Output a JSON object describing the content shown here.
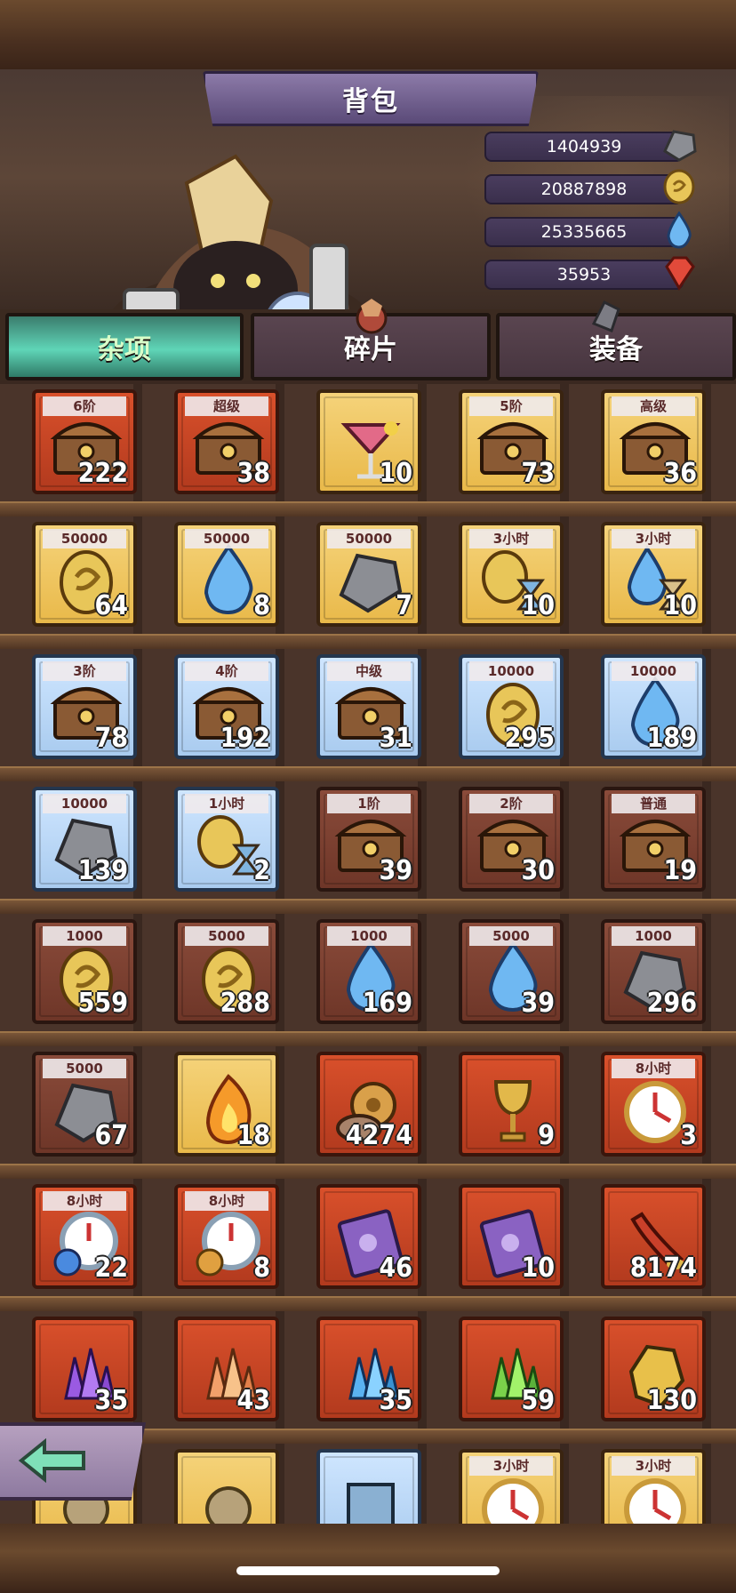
{
  "header": {
    "title": "背包"
  },
  "resources": [
    {
      "value": "1404939",
      "icon": "stone-icon"
    },
    {
      "value": "20887898",
      "icon": "gold-coin-icon"
    },
    {
      "value": "25335665",
      "icon": "water-drop-icon"
    },
    {
      "value": "35953",
      "icon": "red-gem-icon"
    }
  ],
  "tabs": [
    {
      "label": "杂项",
      "active": true
    },
    {
      "label": "碎片",
      "active": false
    },
    {
      "label": "装备",
      "active": false
    }
  ],
  "items": [
    [
      {
        "tag": "6阶",
        "count": "222",
        "icon": "chest-icon",
        "bg": "red"
      },
      {
        "tag": "超级",
        "count": "38",
        "icon": "chest-icon",
        "bg": "red"
      },
      {
        "tag": "",
        "count": "10",
        "icon": "cocktail-icon",
        "bg": "gold"
      },
      {
        "tag": "5阶",
        "count": "73",
        "icon": "chest-icon",
        "bg": "gold"
      },
      {
        "tag": "高级",
        "count": "36",
        "icon": "chest-icon",
        "bg": "gold"
      }
    ],
    [
      {
        "tag": "50000",
        "count": "64",
        "icon": "gold-coin-icon",
        "bg": "gold"
      },
      {
        "tag": "50000",
        "count": "8",
        "icon": "water-drop-icon",
        "bg": "gold"
      },
      {
        "tag": "50000",
        "count": "7",
        "icon": "stone-icon",
        "bg": "gold"
      },
      {
        "tag": "3小时",
        "count": "10",
        "icon": "coin-hourglass-icon",
        "bg": "gold"
      },
      {
        "tag": "3小时",
        "count": "10",
        "icon": "drop-hourglass-icon",
        "bg": "gold"
      }
    ],
    [
      {
        "tag": "3阶",
        "count": "78",
        "icon": "chest-icon",
        "bg": "blue"
      },
      {
        "tag": "4阶",
        "count": "192",
        "icon": "chest-icon",
        "bg": "blue"
      },
      {
        "tag": "中级",
        "count": "31",
        "icon": "chest-icon",
        "bg": "blue"
      },
      {
        "tag": "10000",
        "count": "295",
        "icon": "gold-coin-icon",
        "bg": "blue"
      },
      {
        "tag": "10000",
        "count": "189",
        "icon": "water-drop-icon",
        "bg": "blue"
      }
    ],
    [
      {
        "tag": "10000",
        "count": "139",
        "icon": "stone-icon",
        "bg": "blue"
      },
      {
        "tag": "1小时",
        "count": "2",
        "icon": "coin-hourglass-icon",
        "bg": "blue"
      },
      {
        "tag": "1阶",
        "count": "39",
        "icon": "chest-icon",
        "bg": "brown"
      },
      {
        "tag": "2阶",
        "count": "30",
        "icon": "chest-icon",
        "bg": "brown"
      },
      {
        "tag": "普通",
        "count": "19",
        "icon": "chest-icon",
        "bg": "brown"
      }
    ],
    [
      {
        "tag": "1000",
        "count": "559",
        "icon": "gold-coin-icon",
        "bg": "brown"
      },
      {
        "tag": "5000",
        "count": "288",
        "icon": "gold-coin-icon",
        "bg": "brown"
      },
      {
        "tag": "1000",
        "count": "169",
        "icon": "water-drop-icon",
        "bg": "brown"
      },
      {
        "tag": "5000",
        "count": "39",
        "icon": "water-drop-icon",
        "bg": "brown"
      },
      {
        "tag": "1000",
        "count": "296",
        "icon": "stone-icon",
        "bg": "brown"
      }
    ],
    [
      {
        "tag": "5000",
        "count": "67",
        "icon": "stone-icon",
        "bg": "brown"
      },
      {
        "tag": "",
        "count": "18",
        "icon": "flame-icon",
        "bg": "gold"
      },
      {
        "tag": "",
        "count": "4274",
        "icon": "gears-bag-icon",
        "bg": "red"
      },
      {
        "tag": "",
        "count": "9",
        "icon": "goblet-icon",
        "bg": "red"
      },
      {
        "tag": "8小时",
        "count": "3",
        "icon": "clock-icon",
        "bg": "red"
      }
    ],
    [
      {
        "tag": "8小时",
        "count": "22",
        "icon": "clock-potion-icon",
        "bg": "red"
      },
      {
        "tag": "8小时",
        "count": "8",
        "icon": "clock-gear-icon",
        "bg": "red"
      },
      {
        "tag": "",
        "count": "46",
        "icon": "spellbook-icon",
        "bg": "red"
      },
      {
        "tag": "",
        "count": "10",
        "icon": "spellbook-icon",
        "bg": "red"
      },
      {
        "tag": "",
        "count": "8174",
        "icon": "horn-icon",
        "bg": "red"
      }
    ],
    [
      {
        "tag": "",
        "count": "35",
        "icon": "purple-crystal-icon",
        "bg": "red"
      },
      {
        "tag": "",
        "count": "43",
        "icon": "orange-crystal-icon",
        "bg": "red"
      },
      {
        "tag": "",
        "count": "35",
        "icon": "blue-crystal-icon",
        "bg": "red"
      },
      {
        "tag": "",
        "count": "59",
        "icon": "green-crystal-icon",
        "bg": "red"
      },
      {
        "tag": "",
        "count": "130",
        "icon": "gold-ore-icon",
        "bg": "red"
      }
    ],
    [
      {
        "tag": "",
        "count": "",
        "icon": "gear-item-icon",
        "bg": "gold"
      },
      {
        "tag": "",
        "count": "",
        "icon": "gear-item-icon",
        "bg": "gold"
      },
      {
        "tag": "",
        "count": "",
        "icon": "scroll-icon",
        "bg": "blue"
      },
      {
        "tag": "3小时",
        "count": "",
        "icon": "clock-icon",
        "bg": "gold"
      },
      {
        "tag": "3小时",
        "count": "",
        "icon": "clock-icon",
        "bg": "gold"
      }
    ]
  ],
  "nav": {
    "back": "back-arrow-icon"
  }
}
